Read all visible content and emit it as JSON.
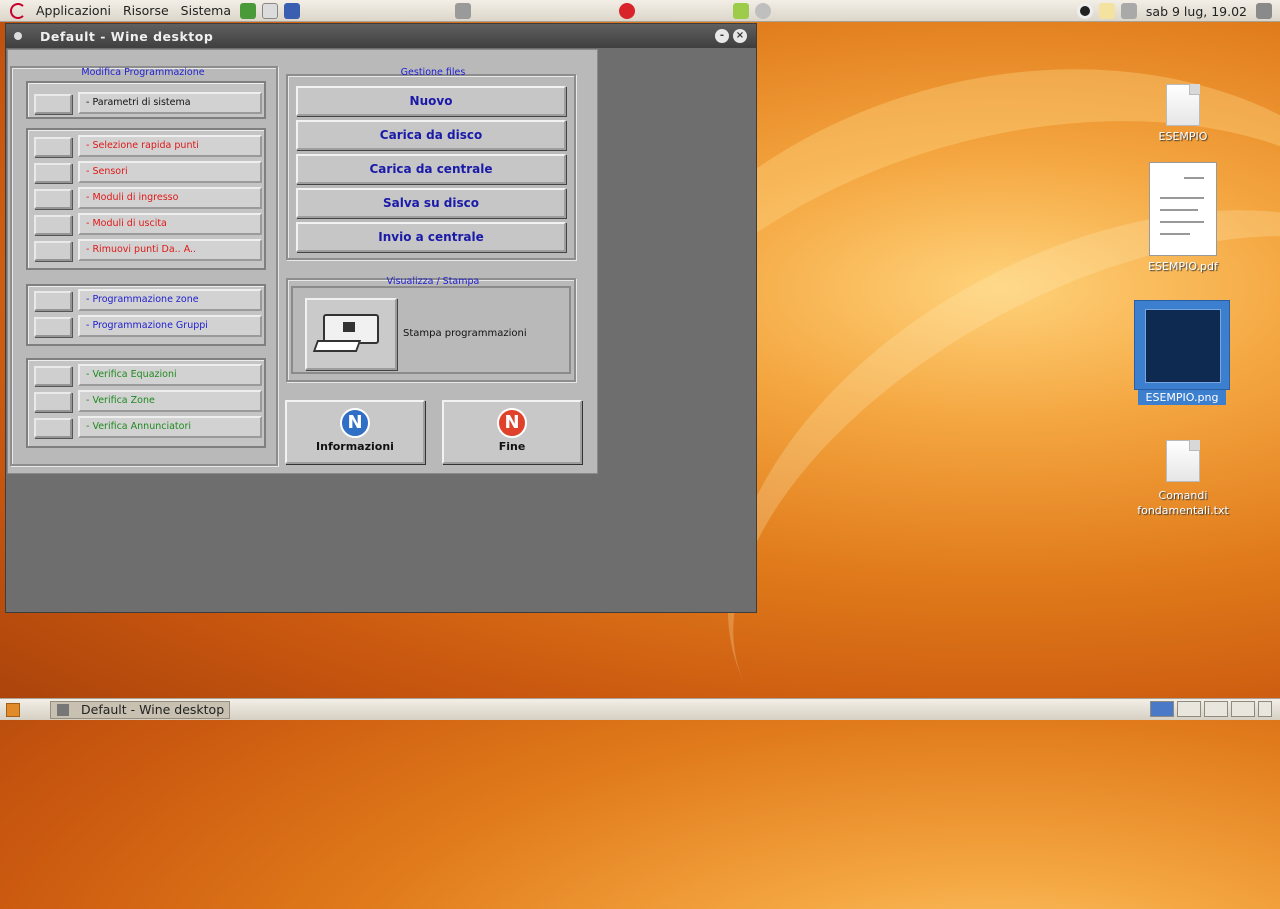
{
  "top_panel": {
    "menus": [
      "Applicazioni",
      "Risorse",
      "Sistema"
    ],
    "clock": "sab  9 lug, 19.02"
  },
  "window": {
    "title": "Default - Wine desktop",
    "minimize_glyph": "-",
    "close_glyph": "×"
  },
  "app": {
    "left_group_title": "Modifica Programmazione",
    "left_items": [
      {
        "label": "- Parametri di sistema",
        "color": "black"
      },
      {
        "label": "- Selezione rapida punti",
        "color": "red"
      },
      {
        "label": "- Sensori",
        "color": "red"
      },
      {
        "label": "- Moduli di ingresso",
        "color": "red"
      },
      {
        "label": "- Moduli di uscita",
        "color": "red"
      },
      {
        "label": "- Rimuovi punti  Da.. A..",
        "color": "red"
      },
      {
        "label": "- Programmazione zone",
        "color": "blue"
      },
      {
        "label": "- Programmazione Gruppi",
        "color": "blue"
      },
      {
        "label": "- Verifica Equazioni",
        "color": "green"
      },
      {
        "label": "- Verifica Zone",
        "color": "green"
      },
      {
        "label": "- Verifica Annunciatori",
        "color": "green"
      }
    ],
    "files_group_title": "Gestione files",
    "file_buttons": [
      "Nuovo",
      "Carica da disco",
      "Carica da centrale",
      "Salva su disco",
      "Invio a centrale"
    ],
    "print_group_title": "Visualizza / Stampa",
    "print_label": "Stampa programmazioni",
    "info_button": "Informazioni",
    "fine_button": "Fine",
    "logo_letter": "N"
  },
  "desktop_icons": [
    {
      "label": "ESEMPIO"
    },
    {
      "label": "ESEMPIO.pdf"
    },
    {
      "label": "ESEMPIO.png"
    },
    {
      "label": "Comandi fondamentali.txt"
    }
  ],
  "taskbar": {
    "task_label": "Default - Wine desktop"
  },
  "colors": {
    "info_logo": "#2f6fc6",
    "fine_logo": "#e0412a",
    "red_text": "#e01818",
    "blue_text": "#2020d0",
    "green_text": "#1f8a1f"
  }
}
